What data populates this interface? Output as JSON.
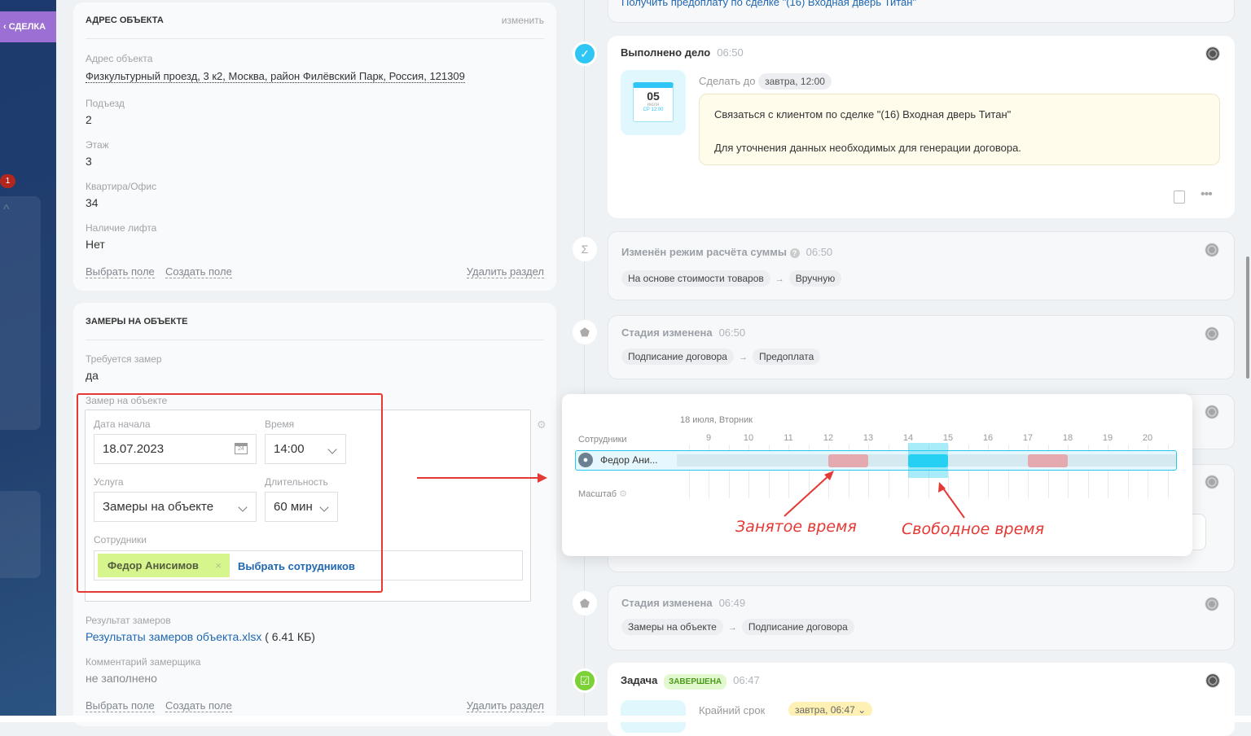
{
  "sidebar": {
    "deal_tab": "СДЕЛКА",
    "badge": "1"
  },
  "address_section": {
    "title": "АДРЕС ОБЪЕКТА",
    "edit": "изменить",
    "fields": [
      {
        "label": "Адрес объекта",
        "value": "Физкультурный проезд, 3 к2, Москва, район Филёвский Парк, Россия, 121309"
      },
      {
        "label": "Подъезд",
        "value": "2"
      },
      {
        "label": "Этаж",
        "value": "3"
      },
      {
        "label": "Квартира/Офис",
        "value": "34"
      },
      {
        "label": "Наличие лифта",
        "value": "Нет"
      }
    ],
    "select_field": "Выбрать поле",
    "create_field": "Создать поле",
    "delete_section": "Удалить раздел"
  },
  "measure_section": {
    "title": "ЗАМЕРЫ НА ОБЪЕКТЕ",
    "need_label": "Требуется замер",
    "need_value": "да",
    "booking_label": "Замер на объекте",
    "date_label": "Дата начала",
    "date_value": "18.07.2023",
    "time_label": "Время",
    "time_value": "14:00",
    "service_label": "Услуга",
    "service_value": "Замеры на объекте",
    "duration_label": "Длительность",
    "duration_value": "60 мин",
    "staff_label": "Сотрудники",
    "staff_tag": "Федор Анисимов",
    "choose_staff": "Выбрать сотрудников",
    "result_label": "Результат замеров",
    "result_file": "Результаты замеров объекта.xlsx",
    "result_size": "( 6.41 КБ)",
    "comment_label": "Комментарий замерщика",
    "comment_value": "не заполнено",
    "select_field": "Выбрать поле",
    "create_field": "Создать поле",
    "delete_section": "Удалить раздел"
  },
  "timeline": {
    "top_card_text": "Получить предоплату по сделке \"(16) Входная дверь Титан\"",
    "done": {
      "title": "Выполнено дело",
      "time": "06:50",
      "deadline_label": "Сделать до",
      "deadline": "завтра, 12:00",
      "cal_day": "05",
      "cal_month": "июля",
      "cal_time": "СР 12:00",
      "text1": "Связаться с клиентом по сделке \"(16) Входная дверь Титан\"",
      "text2": "Для уточнения данных необходимых для генерации договора."
    },
    "sum_mode": {
      "title": "Изменён режим расчёта суммы",
      "time": "06:50",
      "from": "На основе стоимости товаров",
      "to": "Вручную"
    },
    "stage1": {
      "title": "Стадия изменена",
      "time": "06:50",
      "from": "Подписание договора",
      "to": "Предоплата"
    },
    "stage2": {
      "title": "Стадия изменена",
      "time": "06:49",
      "from": "Замеры на объекте",
      "to": "Подписание договора"
    },
    "task": {
      "title": "Задача",
      "status": "ЗАВЕРШЕНА",
      "time": "06:47",
      "deadline_label": "Крайний срок",
      "deadline": "завтра, 06:47"
    }
  },
  "schedule_popup": {
    "date": "18 июля, Вторник",
    "staff_header": "Сотрудники",
    "employee": "Федор Ани...",
    "scale": "Масштаб",
    "hours": [
      "9",
      "10",
      "11",
      "12",
      "13",
      "14",
      "15",
      "16",
      "17",
      "18",
      "19",
      "20"
    ],
    "busy": [
      [
        12,
        13
      ],
      [
        17,
        18
      ]
    ],
    "free": [
      [
        14,
        15
      ]
    ],
    "annot_busy": "Занятое время",
    "annot_free": "Свободное время"
  },
  "colors": {
    "accent": "#2fc6f6",
    "busy": "#e5a9b0",
    "free": "#26d0f2",
    "tag": "#d7f58d",
    "annotation": "#e53935"
  }
}
